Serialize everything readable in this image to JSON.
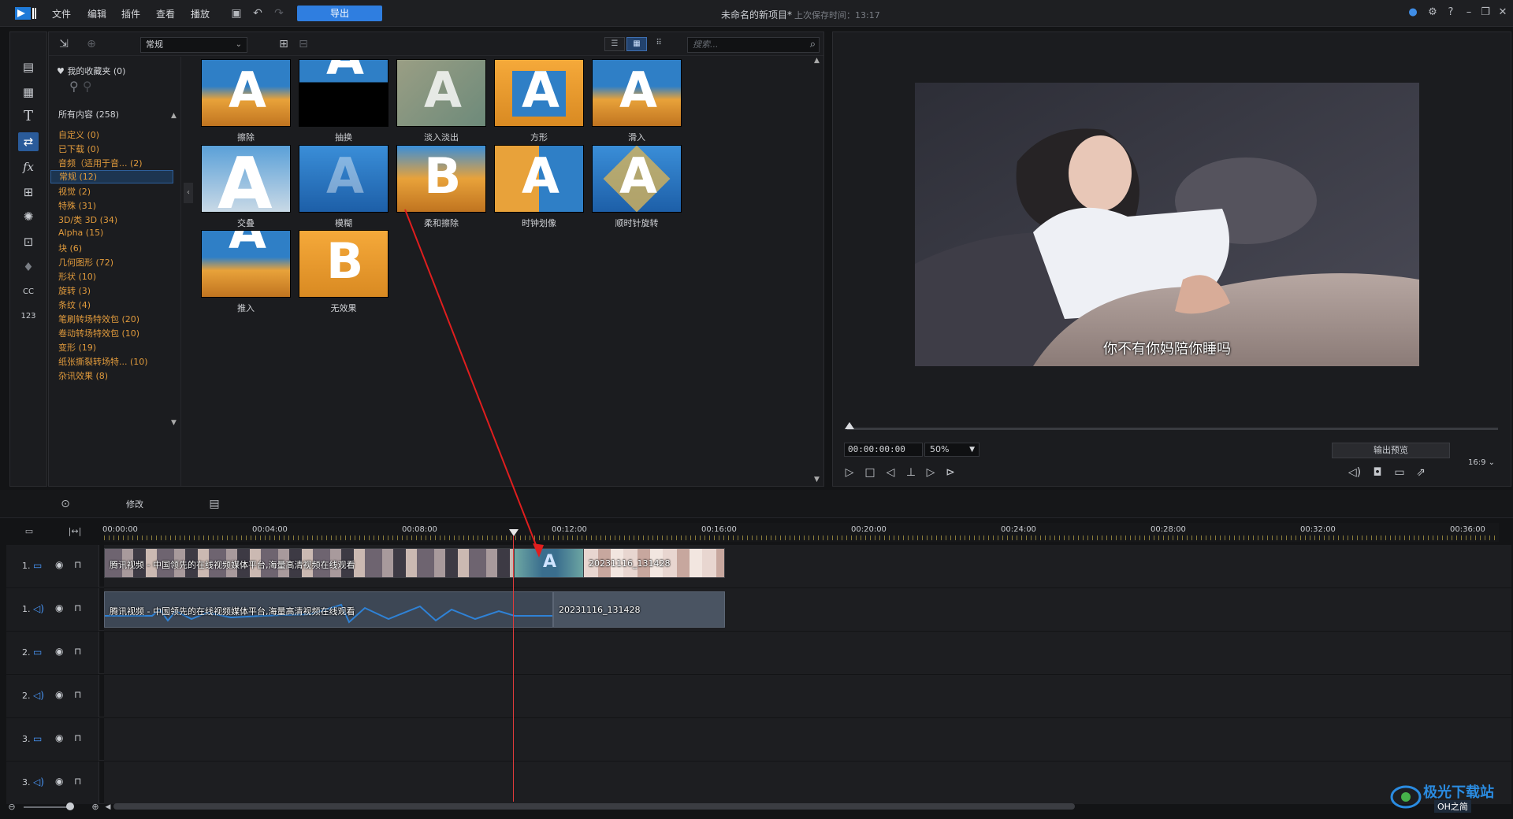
{
  "titlebar": {
    "menus": [
      "文件",
      "编辑",
      "插件",
      "查看",
      "播放"
    ],
    "export_label": "导出",
    "project_title": "未命名的新项目*",
    "saved_label": "上次保存时间：13:17"
  },
  "library": {
    "category_select": "常规",
    "search_placeholder": "搜索...",
    "favorites": "我的收藏夹 (0)",
    "all_content": "所有内容 (258)",
    "categories": [
      "自定义 (0)",
      "已下载 (0)",
      "音频（适用于音... (2)",
      "常规 (12)",
      "视觉 (2)",
      "特殊 (31)",
      "3D/类 3D (34)",
      "Alpha (15)",
      "块 (6)",
      "几何图形 (72)",
      "形状 (10)",
      "旋转 (3)",
      "条纹 (4)",
      "笔刷转场特效包 (20)",
      "卷动转场特效包 (10)",
      "变形 (19)",
      "纸张撕裂转场特... (10)",
      "杂讯效果 (8)"
    ],
    "selected_category_index": 3,
    "transitions": [
      "擦除",
      "抽换",
      "淡入淡出",
      "方形",
      "滑入",
      "交叠",
      "模糊",
      "柔和擦除",
      "时钟划像",
      "顺时针旋转",
      "推入",
      "无效果"
    ]
  },
  "preview": {
    "subtitle": "你不有你妈陪你睡吗",
    "timecode": "00:00:00:00",
    "zoom": "50%",
    "output_preview": "输出预览",
    "aspect": "16:9"
  },
  "timeline": {
    "modify_label": "修改",
    "ruler": [
      "00:00:00",
      "00:04:00",
      "00:08:00",
      "00:12:00",
      "00:16:00",
      "00:20:00",
      "00:24:00",
      "00:28:00",
      "00:32:00",
      "00:36:00"
    ],
    "tracks": [
      {
        "num": "1.",
        "kind": "video"
      },
      {
        "num": "1.",
        "kind": "audio"
      },
      {
        "num": "2.",
        "kind": "video"
      },
      {
        "num": "2.",
        "kind": "audio"
      },
      {
        "num": "3.",
        "kind": "video"
      },
      {
        "num": "3.",
        "kind": "audio"
      }
    ],
    "clip1_label": "腾讯视频 - 中国领先的在线视频媒体平台,海量高清视频在线观看",
    "clip2_label": "20231116_131428",
    "audio1_label": "腾讯视频 - 中国领先的在线视频媒体平台,海量高清视频在线观看",
    "audio2_label": "20231116_131428",
    "transition_glyph": "A"
  },
  "watermark": {
    "text1": "极光下载站",
    "text2": "OH之简"
  },
  "colors": {
    "accent": "#2f7ee0",
    "category_text": "#e09a3c",
    "playhead": "#e23b3b"
  }
}
